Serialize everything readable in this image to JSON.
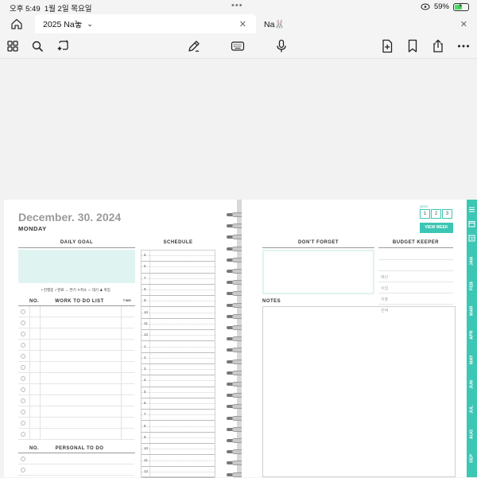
{
  "status_bar": {
    "time": "오후 5:49",
    "date": "1월 2일 목요일",
    "battery_percent_label": "59%",
    "battery_level": 0.59,
    "multitask_dots": "•••"
  },
  "tabs": [
    {
      "label": "2025 Na놓",
      "active": true,
      "close": "✕",
      "chevron": "⌄"
    },
    {
      "label": "Na🐰",
      "active": false,
      "close": "✕"
    }
  ],
  "toolbar": {
    "left_icons": [
      "grid-icon",
      "search-icon",
      "lasso-sparkle-icon"
    ],
    "center_icons": [
      "pen-icon",
      "keyboard-icon",
      "microphone-icon"
    ],
    "right_icons": [
      "add-page-icon",
      "bookmark-icon",
      "share-icon",
      "more-icon"
    ]
  },
  "planner": {
    "date": "December. 30. 2024",
    "weekday": "MONDAY",
    "daily_goal": "DAILY GOAL",
    "legend": "• 진행중  ✓완료  → 연기  ✕취소  ☆ 대기  ♟ 위임",
    "todo_header": {
      "no": "NO.",
      "title": "WORK TO DO LIST",
      "extra": "TIME"
    },
    "personal_header": {
      "no": "NO.",
      "title": "PERSONAL TO DO"
    },
    "schedule_title": "SCHEDULE",
    "schedule_hours": [
      "5",
      "6",
      "7",
      "8",
      "9",
      "10",
      "11",
      "12",
      "1",
      "2",
      "3",
      "4",
      "5",
      "6",
      "7",
      "8",
      "9",
      "10",
      "11",
      "12"
    ],
    "dont_forget": "DON'T FORGET",
    "budget_keeper": "BUDGET KEEPER",
    "budget_rows": [
      "예산",
      "수입",
      "지출",
      "잔액"
    ],
    "notes": "NOTES",
    "week_label": "WEEK",
    "week_numbers": [
      "1",
      "2",
      "3"
    ],
    "view_week": "VIEW WEEK",
    "month_tabs": [
      "JAN",
      "FEB",
      "MAR",
      "APR",
      "MAY",
      "JUN",
      "JUL",
      "AUG",
      "SEP"
    ]
  },
  "colors": {
    "accent": "#3cc6b4",
    "goal_fill": "#dff4f1",
    "date_gray": "#9a9a9a"
  }
}
